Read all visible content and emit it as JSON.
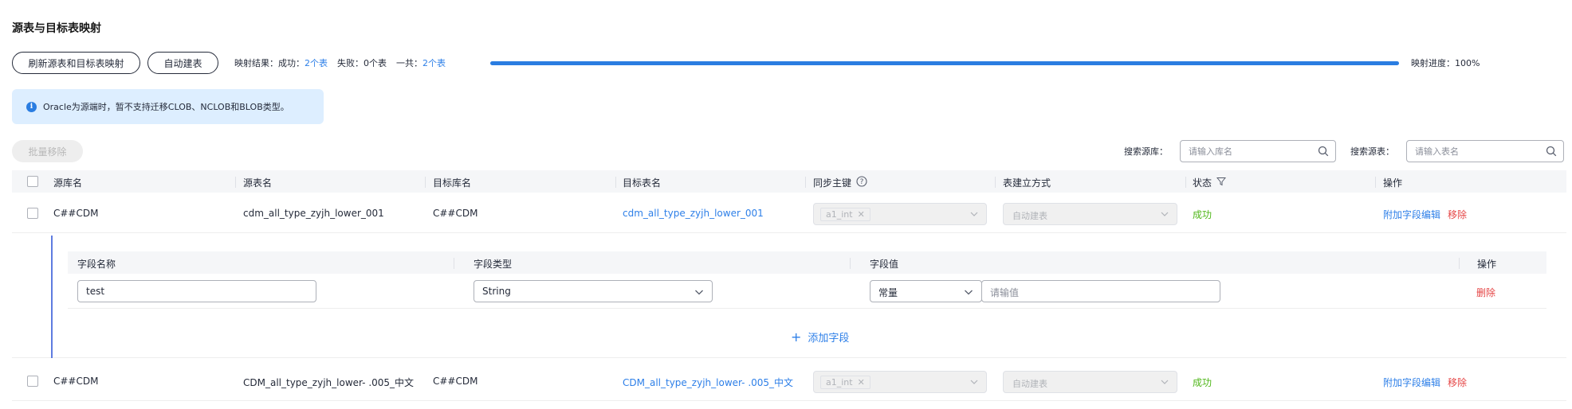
{
  "section": {
    "title": "源表与目标表映射"
  },
  "toolbar": {
    "refresh_label": "刷新源表和目标表映射",
    "auto_label": "自动建表"
  },
  "mapping": {
    "result_prefix": "映射结果：",
    "success_label": "成功：",
    "success_value": "2个表",
    "fail_label": "失败：",
    "fail_value": "0个表",
    "total_label": "一共：",
    "total_value": "2个表",
    "progress_text": "映射进度：100%",
    "progress_percent": 100
  },
  "notice": {
    "icon": "info-icon",
    "text": "Oracle为源端时，暂不支持迁移CLOB、NCLOB和BLOB类型。"
  },
  "batch": {
    "remove_label": "批量移除"
  },
  "search": {
    "db_label": "搜索源库：",
    "db_placeholder": "请输入库名",
    "table_label": "搜索源表：",
    "table_placeholder": "请输入表名"
  },
  "table": {
    "headers": {
      "source_db": "源库名",
      "source_table": "源表名",
      "target_db": "目标库名",
      "target_table": "目标表名",
      "sync_pk": "同步主键",
      "create_mode": "表建立方式",
      "status": "状态",
      "actions": "操作"
    },
    "rows": [
      {
        "source_db": "C##CDM",
        "source_table": "cdm_all_type_zyjh_lower_001",
        "target_db": "C##CDM",
        "target_table": "cdm_all_type_zyjh_lower_001",
        "sync_pk_tag": "a1_int",
        "create_mode": "自动建表",
        "status": "成功",
        "edit_label": "附加字段编辑",
        "remove_label": "移除"
      },
      {
        "source_db": "C##CDM",
        "source_table": "CDM_all_type_zyjh_lower- .005_中文",
        "target_db": "C##CDM",
        "target_table": "CDM_all_type_zyjh_lower- .005_中文",
        "sync_pk_tag": "a1_int",
        "create_mode": "自动建表",
        "status": "成功",
        "edit_label": "附加字段编辑",
        "remove_label": "移除"
      }
    ]
  },
  "fields": {
    "headers": {
      "name": "字段名称",
      "type": "字段类型",
      "value": "字段值",
      "actions": "操作"
    },
    "rows": [
      {
        "name": "test",
        "type": "String",
        "value_mode": "常量",
        "value_placeholder": "请输值",
        "delete_label": "删除"
      }
    ],
    "add_label": "添加字段"
  },
  "colors": {
    "link": "#2d7fe8",
    "success": "#50b71a",
    "danger": "#e54545",
    "progress": "#2a7de1"
  }
}
